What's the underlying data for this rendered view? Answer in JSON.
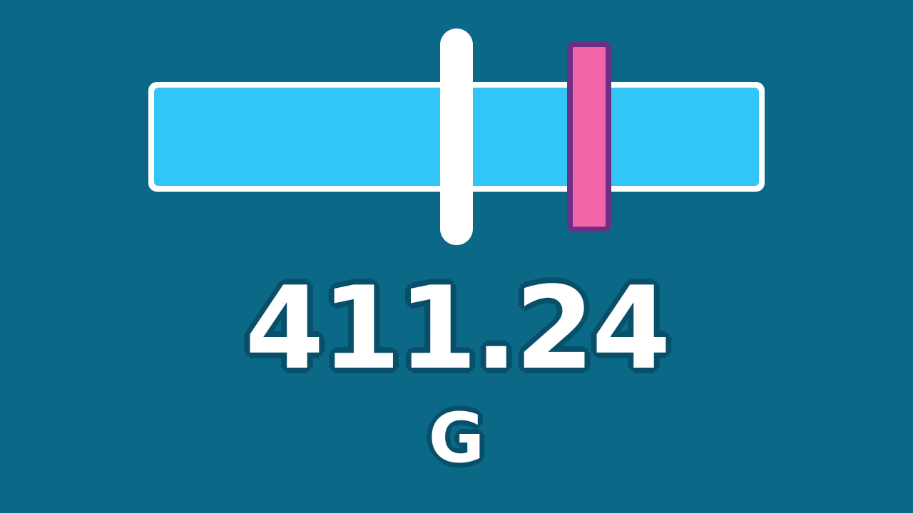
{
  "colors": {
    "background": "#0c6887",
    "track_border": "#ffffff",
    "track_fill": "#31c6f7",
    "target_marker": "#ffffff",
    "player_marker_fill": "#f265a8",
    "player_marker_border": "#6b2f86",
    "text_outline": "#08506a"
  },
  "meter": {
    "target_position": 0.5,
    "player_position": 0.715
  },
  "readout": {
    "value": "411.24",
    "unit": "G"
  }
}
